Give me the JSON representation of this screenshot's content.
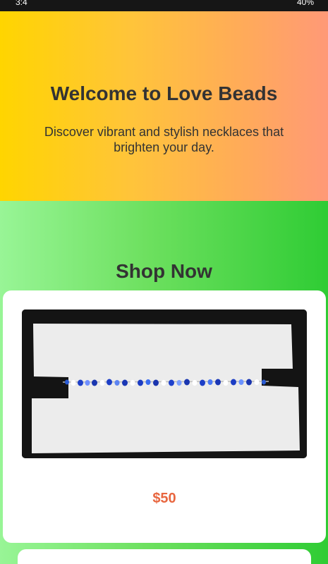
{
  "status_bar": {
    "left_text": "3:4",
    "right_text": "40%"
  },
  "hero": {
    "title": "Welcome to Love Beads",
    "subtitle": "Discover vibrant and stylish necklaces that brighten your day."
  },
  "shop": {
    "title": "Shop Now",
    "products": [
      {
        "image_icon": "bead-necklace-photo",
        "price": "$50"
      }
    ]
  },
  "colors": {
    "hero_gradient": [
      "#ffd500",
      "#ff9977"
    ],
    "shop_gradient": [
      "#98f596",
      "#2fcc34"
    ],
    "price": "#e8663f",
    "nav_tab": "#f05a28"
  }
}
